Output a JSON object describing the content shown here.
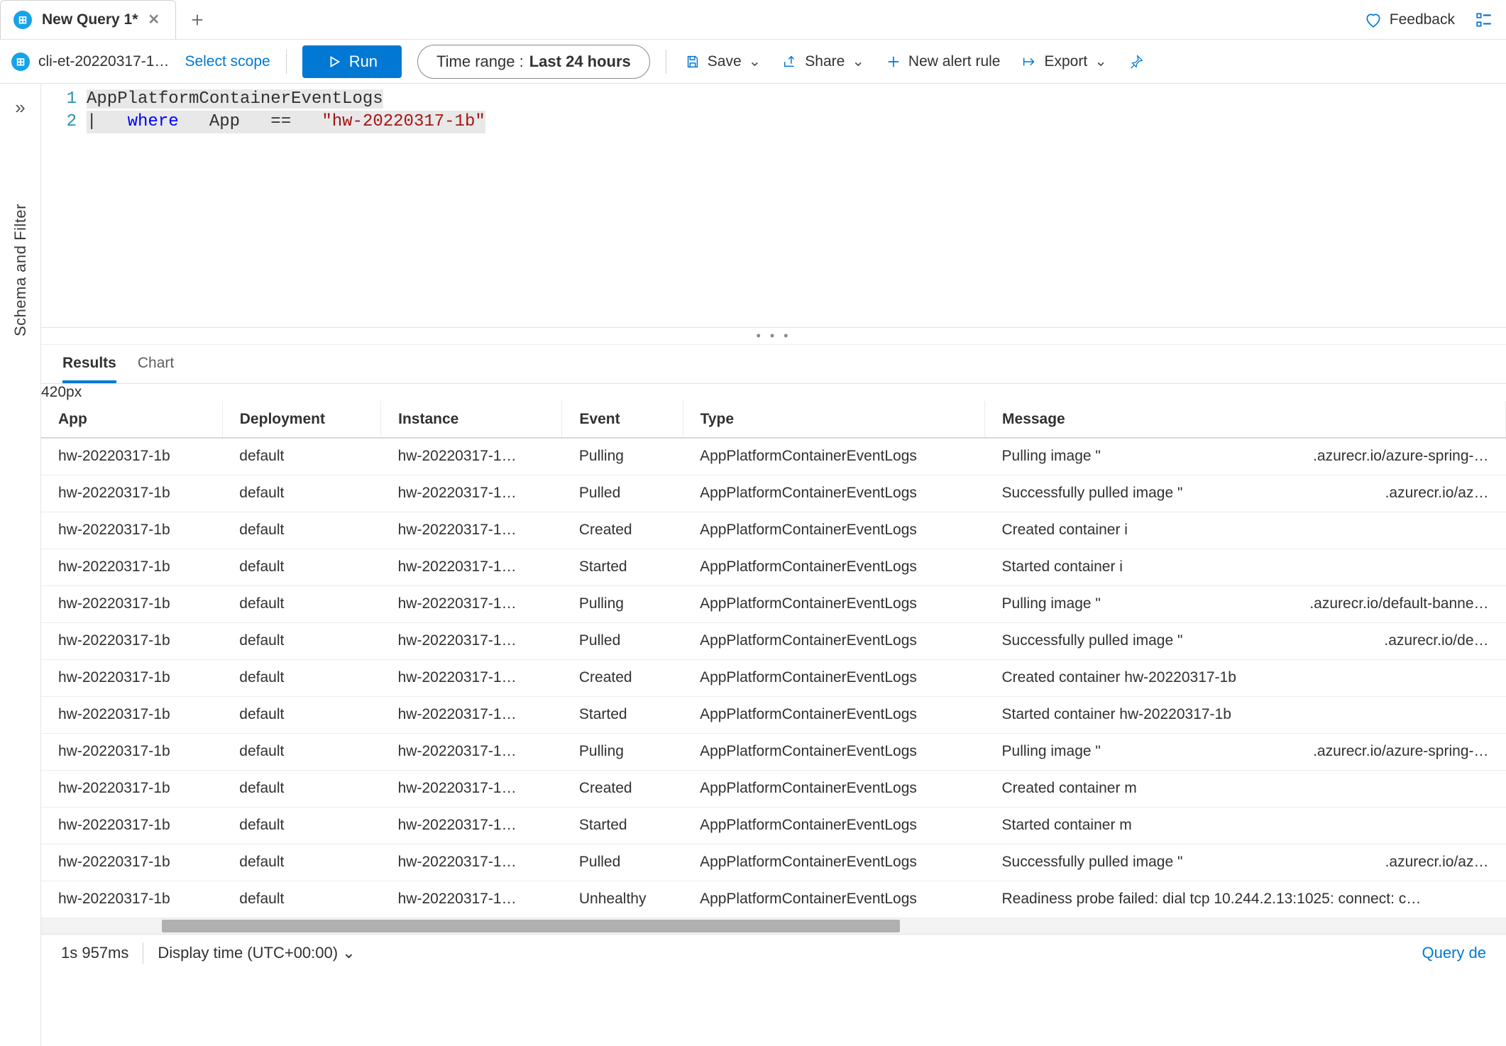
{
  "tabs": {
    "active_title": "New Query 1*"
  },
  "header_right": {
    "feedback": "Feedback"
  },
  "toolbar": {
    "workspace": "cli-et-20220317-1…",
    "select_scope": "Select scope",
    "run": "Run",
    "time_range_label": "Time range :",
    "time_range_value": "Last 24 hours",
    "save": "Save",
    "share": "Share",
    "new_alert_rule": "New alert rule",
    "export": "Export"
  },
  "editor": {
    "line_numbers": [
      "1",
      "2"
    ],
    "line1_identifier": "AppPlatformContainerEventLogs",
    "line2_pipe": "|",
    "line2_where": "where",
    "line2_app": "App",
    "line2_eq": "==",
    "line2_str": "\"hw-20220317-1b\""
  },
  "left_rail": {
    "label": "Schema and Filter"
  },
  "result_tabs": {
    "results": "Results",
    "chart": "Chart"
  },
  "table": {
    "columns": [
      "App",
      "Deployment",
      "Instance",
      "Event",
      "Type",
      "Message"
    ],
    "rows": [
      {
        "app": "hw-20220317-1b",
        "deployment": "default",
        "instance": "hw-20220317-1…",
        "event": "Pulling",
        "type": "AppPlatformContainerEventLogs",
        "msg_l": "Pulling image \"",
        "msg_r": ".azurecr.io/azure-spring-…"
      },
      {
        "app": "hw-20220317-1b",
        "deployment": "default",
        "instance": "hw-20220317-1…",
        "event": "Pulled",
        "type": "AppPlatformContainerEventLogs",
        "msg_l": "Successfully pulled image \"",
        "msg_r": ".azurecr.io/az…"
      },
      {
        "app": "hw-20220317-1b",
        "deployment": "default",
        "instance": "hw-20220317-1…",
        "event": "Created",
        "type": "AppPlatformContainerEventLogs",
        "msg_l": "Created container i",
        "msg_r": ""
      },
      {
        "app": "hw-20220317-1b",
        "deployment": "default",
        "instance": "hw-20220317-1…",
        "event": "Started",
        "type": "AppPlatformContainerEventLogs",
        "msg_l": "Started container i",
        "msg_r": ""
      },
      {
        "app": "hw-20220317-1b",
        "deployment": "default",
        "instance": "hw-20220317-1…",
        "event": "Pulling",
        "type": "AppPlatformContainerEventLogs",
        "msg_l": "Pulling image \"",
        "msg_r": ".azurecr.io/default-banne…"
      },
      {
        "app": "hw-20220317-1b",
        "deployment": "default",
        "instance": "hw-20220317-1…",
        "event": "Pulled",
        "type": "AppPlatformContainerEventLogs",
        "msg_l": "Successfully pulled image \"",
        "msg_r": ".azurecr.io/de…"
      },
      {
        "app": "hw-20220317-1b",
        "deployment": "default",
        "instance": "hw-20220317-1…",
        "event": "Created",
        "type": "AppPlatformContainerEventLogs",
        "msg_l": "Created container hw-20220317-1b",
        "msg_r": ""
      },
      {
        "app": "hw-20220317-1b",
        "deployment": "default",
        "instance": "hw-20220317-1…",
        "event": "Started",
        "type": "AppPlatformContainerEventLogs",
        "msg_l": "Started container hw-20220317-1b",
        "msg_r": ""
      },
      {
        "app": "hw-20220317-1b",
        "deployment": "default",
        "instance": "hw-20220317-1…",
        "event": "Pulling",
        "type": "AppPlatformContainerEventLogs",
        "msg_l": "Pulling image \"",
        "msg_r": ".azurecr.io/azure-spring-…"
      },
      {
        "app": "hw-20220317-1b",
        "deployment": "default",
        "instance": "hw-20220317-1…",
        "event": "Created",
        "type": "AppPlatformContainerEventLogs",
        "msg_l": "Created container m",
        "msg_r": ""
      },
      {
        "app": "hw-20220317-1b",
        "deployment": "default",
        "instance": "hw-20220317-1…",
        "event": "Started",
        "type": "AppPlatformContainerEventLogs",
        "msg_l": "Started container m",
        "msg_r": ""
      },
      {
        "app": "hw-20220317-1b",
        "deployment": "default",
        "instance": "hw-20220317-1…",
        "event": "Pulled",
        "type": "AppPlatformContainerEventLogs",
        "msg_l": "Successfully pulled image \"",
        "msg_r": ".azurecr.io/az…"
      },
      {
        "app": "hw-20220317-1b",
        "deployment": "default",
        "instance": "hw-20220317-1…",
        "event": "Unhealthy",
        "type": "AppPlatformContainerEventLogs",
        "msg_l": "Readiness probe failed: dial tcp 10.244.2.13:1025: connect: c…",
        "msg_r": ""
      }
    ]
  },
  "status": {
    "elapsed": "1s 957ms",
    "display_time": "Display time (UTC+00:00)",
    "query_detail": "Query de"
  }
}
